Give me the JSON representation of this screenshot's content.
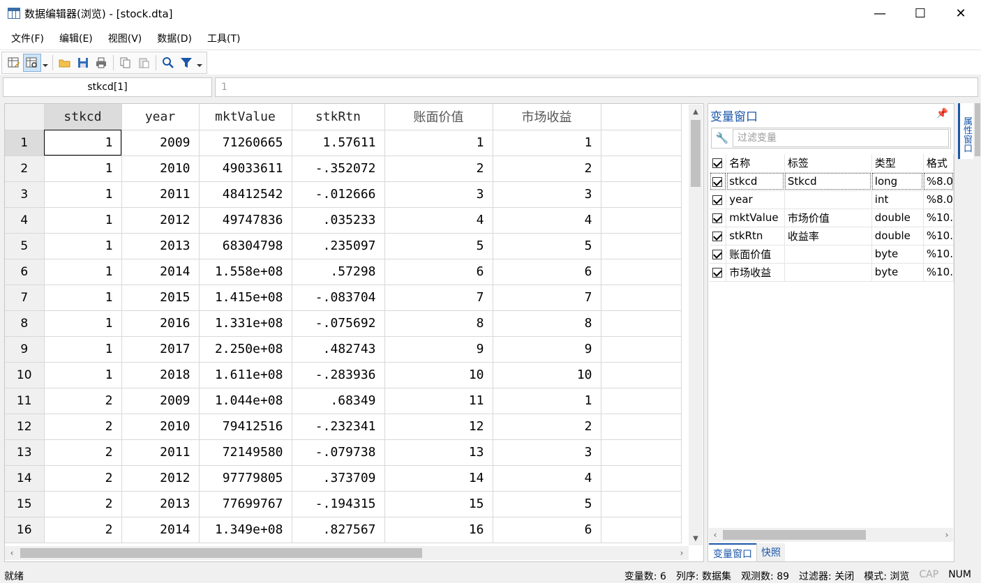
{
  "window": {
    "title": "数据编辑器(浏览) - [stock.dta]",
    "minimize": "—",
    "maximize": "☐",
    "close": "✕"
  },
  "menu": [
    "文件(F)",
    "编辑(E)",
    "视图(V)",
    "数据(D)",
    "工具(T)"
  ],
  "editbar": {
    "cell_ref": "stkcd[1]",
    "cell_value": "1"
  },
  "grid": {
    "columns": [
      "stkcd",
      "year",
      "mktValue",
      "stkRtn",
      "账面价值",
      "市场收益"
    ],
    "rows": [
      [
        "1",
        "1",
        "2009",
        "71260665",
        "1.57611",
        "1",
        "1"
      ],
      [
        "2",
        "1",
        "2010",
        "49033611",
        "-.352072",
        "2",
        "2"
      ],
      [
        "3",
        "1",
        "2011",
        "48412542",
        "-.012666",
        "3",
        "3"
      ],
      [
        "4",
        "1",
        "2012",
        "49747836",
        ".035233",
        "4",
        "4"
      ],
      [
        "5",
        "1",
        "2013",
        "68304798",
        ".235097",
        "5",
        "5"
      ],
      [
        "6",
        "1",
        "2014",
        "1.558e+08",
        ".57298",
        "6",
        "6"
      ],
      [
        "7",
        "1",
        "2015",
        "1.415e+08",
        "-.083704",
        "7",
        "7"
      ],
      [
        "8",
        "1",
        "2016",
        "1.331e+08",
        "-.075692",
        "8",
        "8"
      ],
      [
        "9",
        "1",
        "2017",
        "2.250e+08",
        ".482743",
        "9",
        "9"
      ],
      [
        "10",
        "1",
        "2018",
        "1.611e+08",
        "-.283936",
        "10",
        "10"
      ],
      [
        "11",
        "2",
        "2009",
        "1.044e+08",
        ".68349",
        "11",
        "1"
      ],
      [
        "12",
        "2",
        "2010",
        "79412516",
        "-.232341",
        "12",
        "2"
      ],
      [
        "13",
        "2",
        "2011",
        "72149580",
        "-.079738",
        "13",
        "3"
      ],
      [
        "14",
        "2",
        "2012",
        "97779805",
        ".373709",
        "14",
        "4"
      ],
      [
        "15",
        "2",
        "2013",
        "77699767",
        "-.194315",
        "15",
        "5"
      ],
      [
        "16",
        "2",
        "2014",
        "1.349e+08",
        ".827567",
        "16",
        "6"
      ]
    ]
  },
  "varpanel": {
    "title": "变量窗口",
    "filter_placeholder": "过滤变量",
    "headers": [
      "名称",
      "标签",
      "类型",
      "格式"
    ],
    "variables": [
      [
        "stkcd",
        "Stkcd",
        "long",
        "%8.0"
      ],
      [
        "year",
        "",
        "int",
        "%8.0"
      ],
      [
        "mktValue",
        "市场价值",
        "double",
        "%10."
      ],
      [
        "stkRtn",
        "收益率",
        "double",
        "%10."
      ],
      [
        "账面价值",
        "",
        "byte",
        "%10."
      ],
      [
        "市场收益",
        "",
        "byte",
        "%10."
      ]
    ],
    "tabs": [
      "变量窗口",
      "快照"
    ]
  },
  "sidetab": "属性窗口",
  "statusbar": {
    "ready": "就绪",
    "var_count": "变量数: 6",
    "order": "列序: 数据集",
    "obs_count": "观测数: 89",
    "filter": "过滤器: 关闭",
    "mode": "模式: 浏览",
    "cap": "CAP",
    "num": "NUM"
  },
  "colors": {
    "accent": "#1a56a8",
    "selection": "#dcdcdc"
  }
}
